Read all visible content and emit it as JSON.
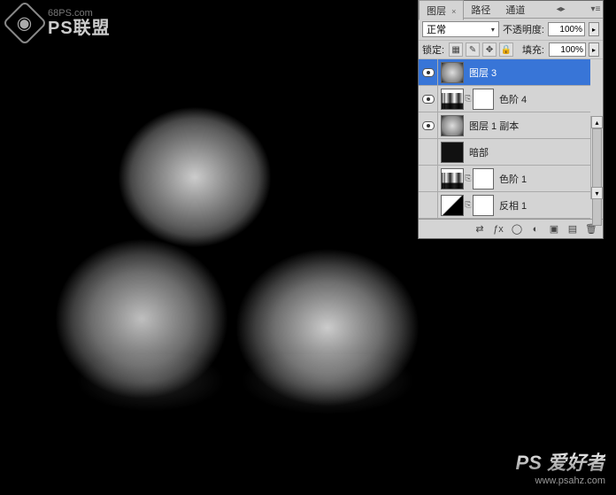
{
  "watermark_top": {
    "url": "68PS.com",
    "brand": "PS联盟"
  },
  "watermark_bottom": {
    "brand": "PS 爱好者",
    "url": "www.psahz.com"
  },
  "panel": {
    "tabs": {
      "layers": "图层",
      "paths": "路径",
      "channels": "通道"
    },
    "blend_mode": "正常",
    "opacity_label": "不透明度:",
    "opacity_value": "100%",
    "lock_label": "锁定:",
    "fill_label": "填充:",
    "fill_value": "100%",
    "layers": [
      {
        "name": "图层 3"
      },
      {
        "name": "色阶 4"
      },
      {
        "name": "图层 1 副本"
      },
      {
        "name": "暗部"
      },
      {
        "name": "色阶 1"
      },
      {
        "name": "反相 1"
      }
    ]
  }
}
